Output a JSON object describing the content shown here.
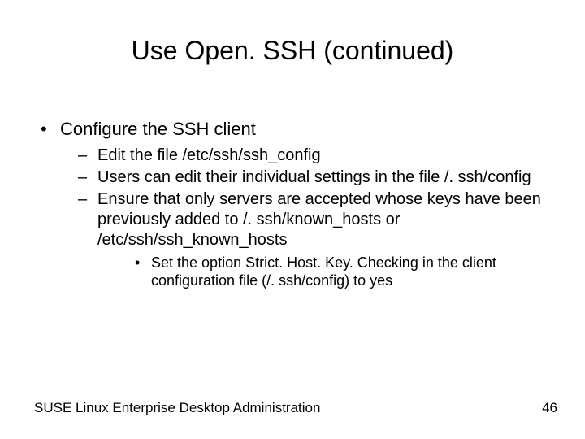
{
  "title": "Use Open. SSH (continued)",
  "bullets": {
    "l1_0": "Configure the SSH client",
    "l2_0": "Edit the file /etc/ssh/ssh_config",
    "l2_1": "Users can edit their individual settings in the file /. ssh/config",
    "l2_2": "Ensure that only servers are accepted whose keys have been previously added to /. ssh/known_hosts or /etc/ssh/ssh_known_hosts",
    "l3_0": "Set the option Strict. Host. Key. Checking in the client configuration file (/. ssh/config) to yes"
  },
  "footer": {
    "left": "SUSE Linux Enterprise Desktop Administration",
    "right": "46"
  }
}
